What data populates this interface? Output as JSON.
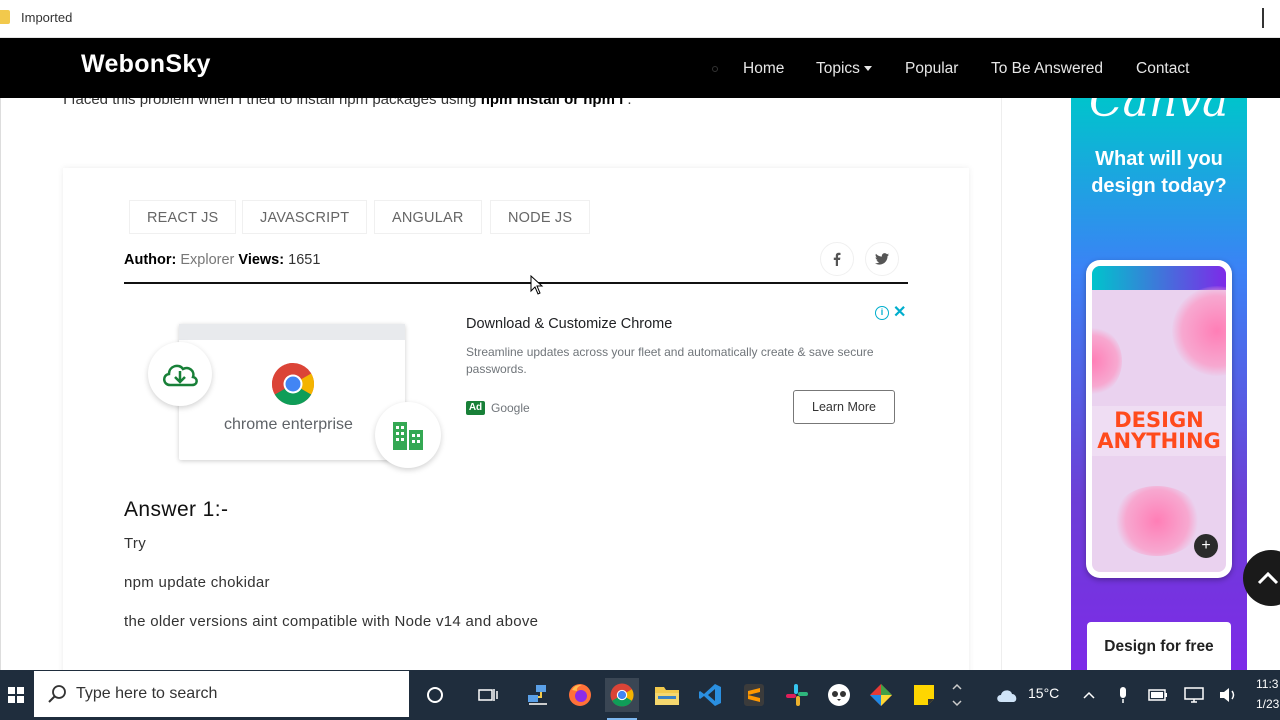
{
  "browser": {
    "bookmark_folder": "Imported"
  },
  "nav": {
    "brand": "WebonSky",
    "items": [
      "Home",
      "Topics",
      "Popular",
      "To Be Answered",
      "Contact"
    ]
  },
  "article": {
    "intro_prefix": "I faced this problem when I tried to install npm packages using ",
    "intro_bold": "npm install or npm i",
    "intro_suffix": " .",
    "tags": [
      "REACT JS",
      "JAVASCRIPT",
      "ANGULAR",
      "NODE JS"
    ],
    "author_label": "Author:",
    "author_name": "Explorer",
    "views_label": "Views:",
    "views_count": "1651",
    "answer_heading": "Answer 1:-",
    "answer_lines": [
      "Try",
      "npm update chokidar",
      "the older versions aint compatible with Node v14 and above"
    ]
  },
  "google_ad": {
    "title": "Download & Customize Chrome",
    "description": "Streamline updates across your fleet and automatically create & save secure passwords.",
    "badge": "Ad",
    "source": "Google",
    "cta": "Learn More",
    "image_label": "chrome enterprise",
    "info_glyph": "i",
    "close_glyph": "✕"
  },
  "side_ad": {
    "logo": "Canva",
    "headline": "What will you design today?",
    "phone_text": "DESIGN ANYTHING",
    "plus_glyph": "+",
    "cta": "Design for free"
  },
  "taskbar": {
    "search_placeholder": "Type here to search",
    "weather": "15°C",
    "clock_time": "11:3",
    "clock_date": "1/23"
  },
  "colors": {
    "navbar_bg": "#000000",
    "taskbar_bg": "#1f2d3d",
    "ad_badge": "#188038",
    "ad_info": "#00aecd",
    "canva_purple": "#7d2ae8"
  }
}
